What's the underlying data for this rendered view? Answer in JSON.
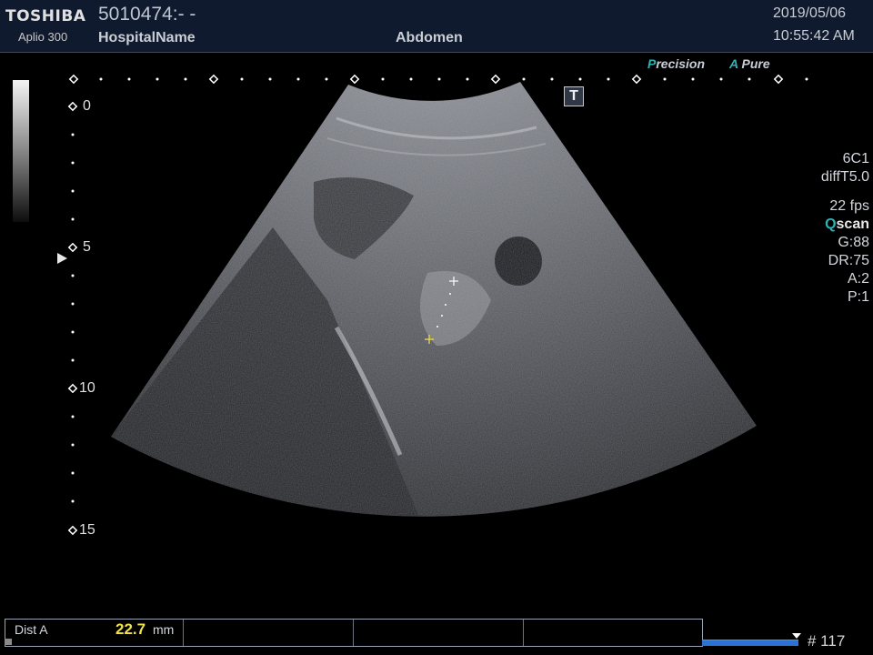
{
  "header": {
    "brand": "TOSHIBA",
    "model": "Aplio 300",
    "patient_id": "5010474:- -",
    "hospital": "HospitalName",
    "preset": "Abdomen",
    "date": "2019/05/06",
    "time": "10:55:42 AM"
  },
  "features": [
    {
      "accent": "P",
      "rest": "recision"
    },
    {
      "accent": "A",
      "rest": " Pure"
    }
  ],
  "depth_labels": [
    "0",
    "5",
    "10",
    "15"
  ],
  "t_icon": "T",
  "params": {
    "probe": "6C1",
    "mode": "diffT5.0",
    "fps": "22 fps",
    "qscan_accent": "Q",
    "qscan_rest": "scan",
    "gain": "G:88",
    "dr": "DR:75",
    "a": "A:2",
    "p": "P:1"
  },
  "measurement": {
    "name": "Dist A",
    "value": "22.7",
    "unit": "mm"
  },
  "cine": {
    "frame": "# 117",
    "position": 1.0
  },
  "colors": {
    "accent_teal": "#2fb3b3",
    "measure_yellow": "#f2e24a",
    "header_bg": "#0f1a2e",
    "cine_blue": "#2a73d4"
  }
}
